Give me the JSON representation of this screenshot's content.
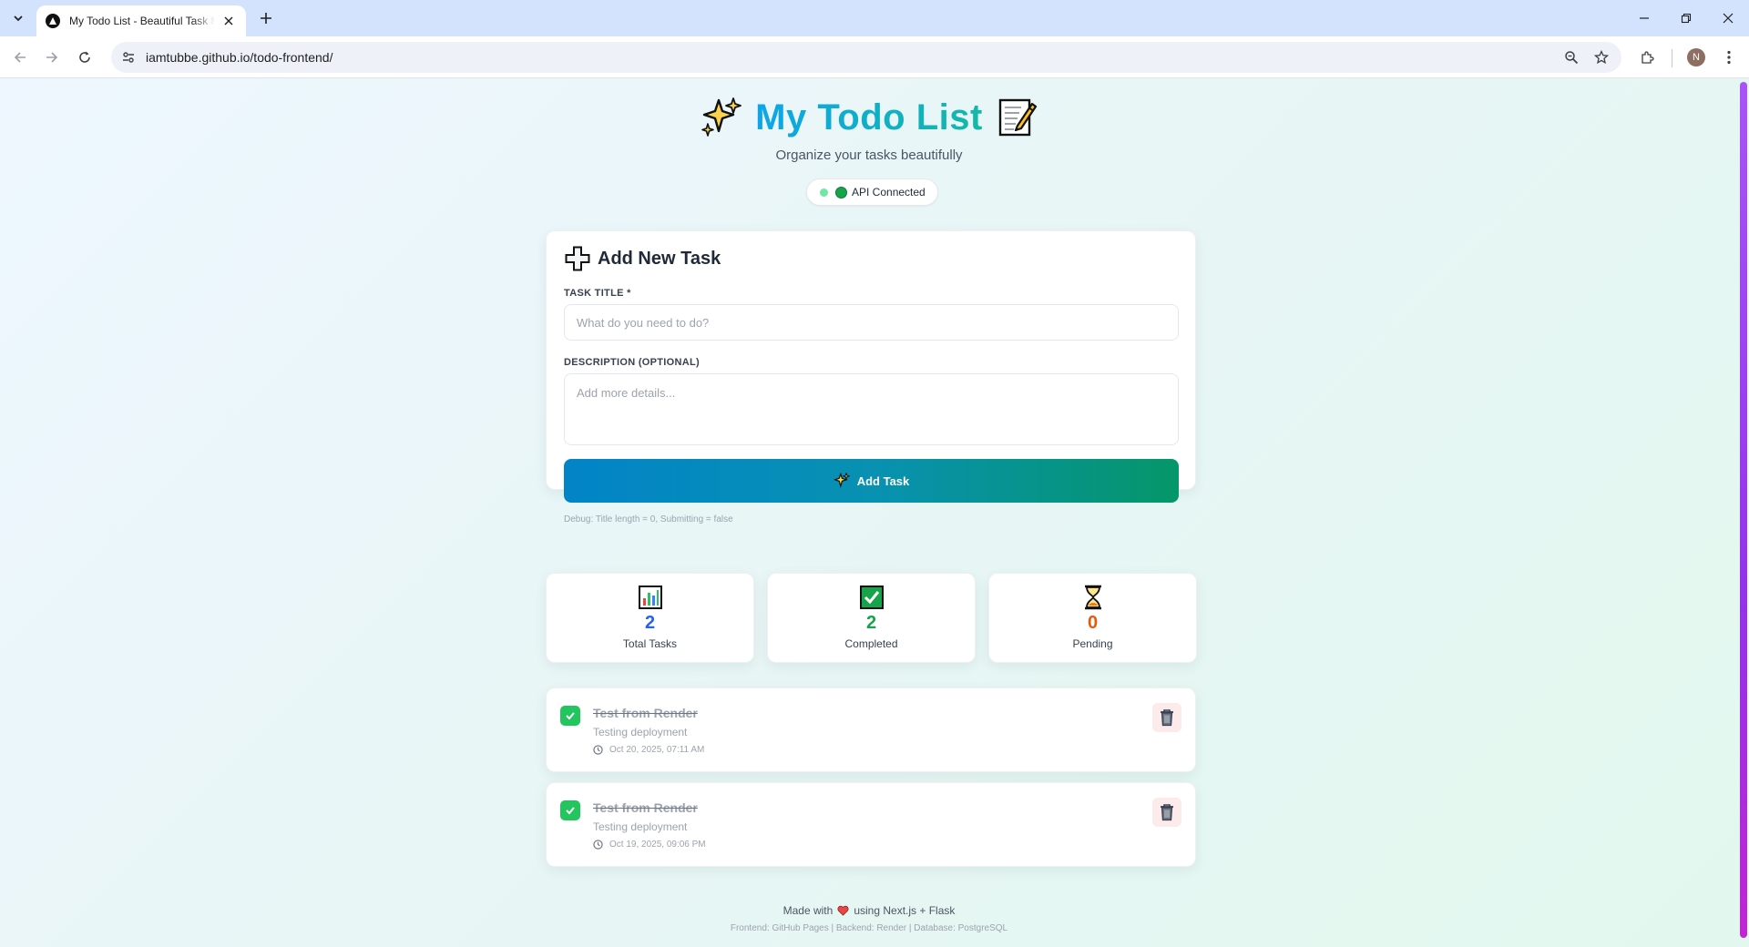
{
  "browser": {
    "tab_title": "My Todo List - Beautiful Task Manager",
    "url": "iamtubbe.github.io/todo-frontend/",
    "profile_initial": "N"
  },
  "page": {
    "title": "My Todo List",
    "subtitle": "Organize your tasks beautifully",
    "api_status": "API Connected"
  },
  "form": {
    "heading": "Add New Task",
    "title_label": "TASK TITLE *",
    "title_value": "",
    "title_placeholder": "What do you need to do?",
    "description_label": "DESCRIPTION (OPTIONAL)",
    "description_value": "",
    "description_placeholder": "Add more details...",
    "submit_label": "Add Task",
    "debug": "Debug: Title length = 0, Submitting = false"
  },
  "stats": [
    {
      "icon": "bar-chart-icon",
      "value": "2",
      "label": "Total Tasks",
      "color": "#2563eb"
    },
    {
      "icon": "check-box-icon",
      "value": "2",
      "label": "Completed",
      "color": "#16a34a"
    },
    {
      "icon": "hourglass-icon",
      "value": "0",
      "label": "Pending",
      "color": "#ea580c"
    }
  ],
  "tasks": [
    {
      "title": "Test from Render",
      "description": "Testing deployment",
      "time": "Oct 20, 2025, 07:11 AM",
      "completed": true
    },
    {
      "title": "Test from Render",
      "description": "Testing deployment",
      "time": "Oct 19, 2025, 09:06 PM",
      "completed": true
    }
  ],
  "footer": {
    "made_with_prefix": "Made with",
    "made_with_suffix": "using Next.js + Flask",
    "stack": "Frontend: GitHub Pages | Backend: Render | Database: PostgreSQL"
  },
  "colors": {
    "accent_from": "#0ea5e9",
    "accent_to": "#14b8a6",
    "button_from": "#0284c7",
    "button_to": "#059669",
    "completed_check": "#22c55e"
  }
}
